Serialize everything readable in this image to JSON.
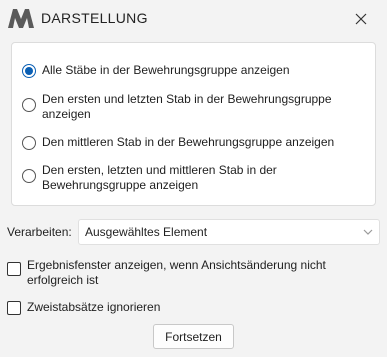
{
  "window": {
    "title": "DARSTELLUNG",
    "logo_icon": "brand-logo-icon",
    "close_icon": "close-icon"
  },
  "display_options": {
    "selected_index": 0,
    "items": [
      {
        "label": "Alle Stäbe in der Bewehrungsgruppe anzeigen"
      },
      {
        "label": "Den ersten und letzten Stab in der Bewehrungsgruppe anzeigen"
      },
      {
        "label": "Den mittleren Stab in der Bewehrungsgruppe anzeigen"
      },
      {
        "label": "Den ersten, letzten und mittleren Stab in der Bewehrungsgruppe anzeigen"
      }
    ]
  },
  "processing": {
    "label": "Verarbeiten:",
    "selected_value": "Ausgewähltes Element"
  },
  "checkboxes": {
    "result_window": {
      "label": "Ergebnisfenster anzeigen, wenn Ansichtsänderung nicht erfolgreich ist",
      "checked": false
    },
    "ignore_two_way": {
      "label": "Zweistabsätze ignorieren",
      "checked": false
    }
  },
  "actions": {
    "continue_label": "Fortsetzen"
  },
  "colors": {
    "accent": "#0a5fb4",
    "background": "#f3f3f3",
    "panel": "#ffffff"
  }
}
